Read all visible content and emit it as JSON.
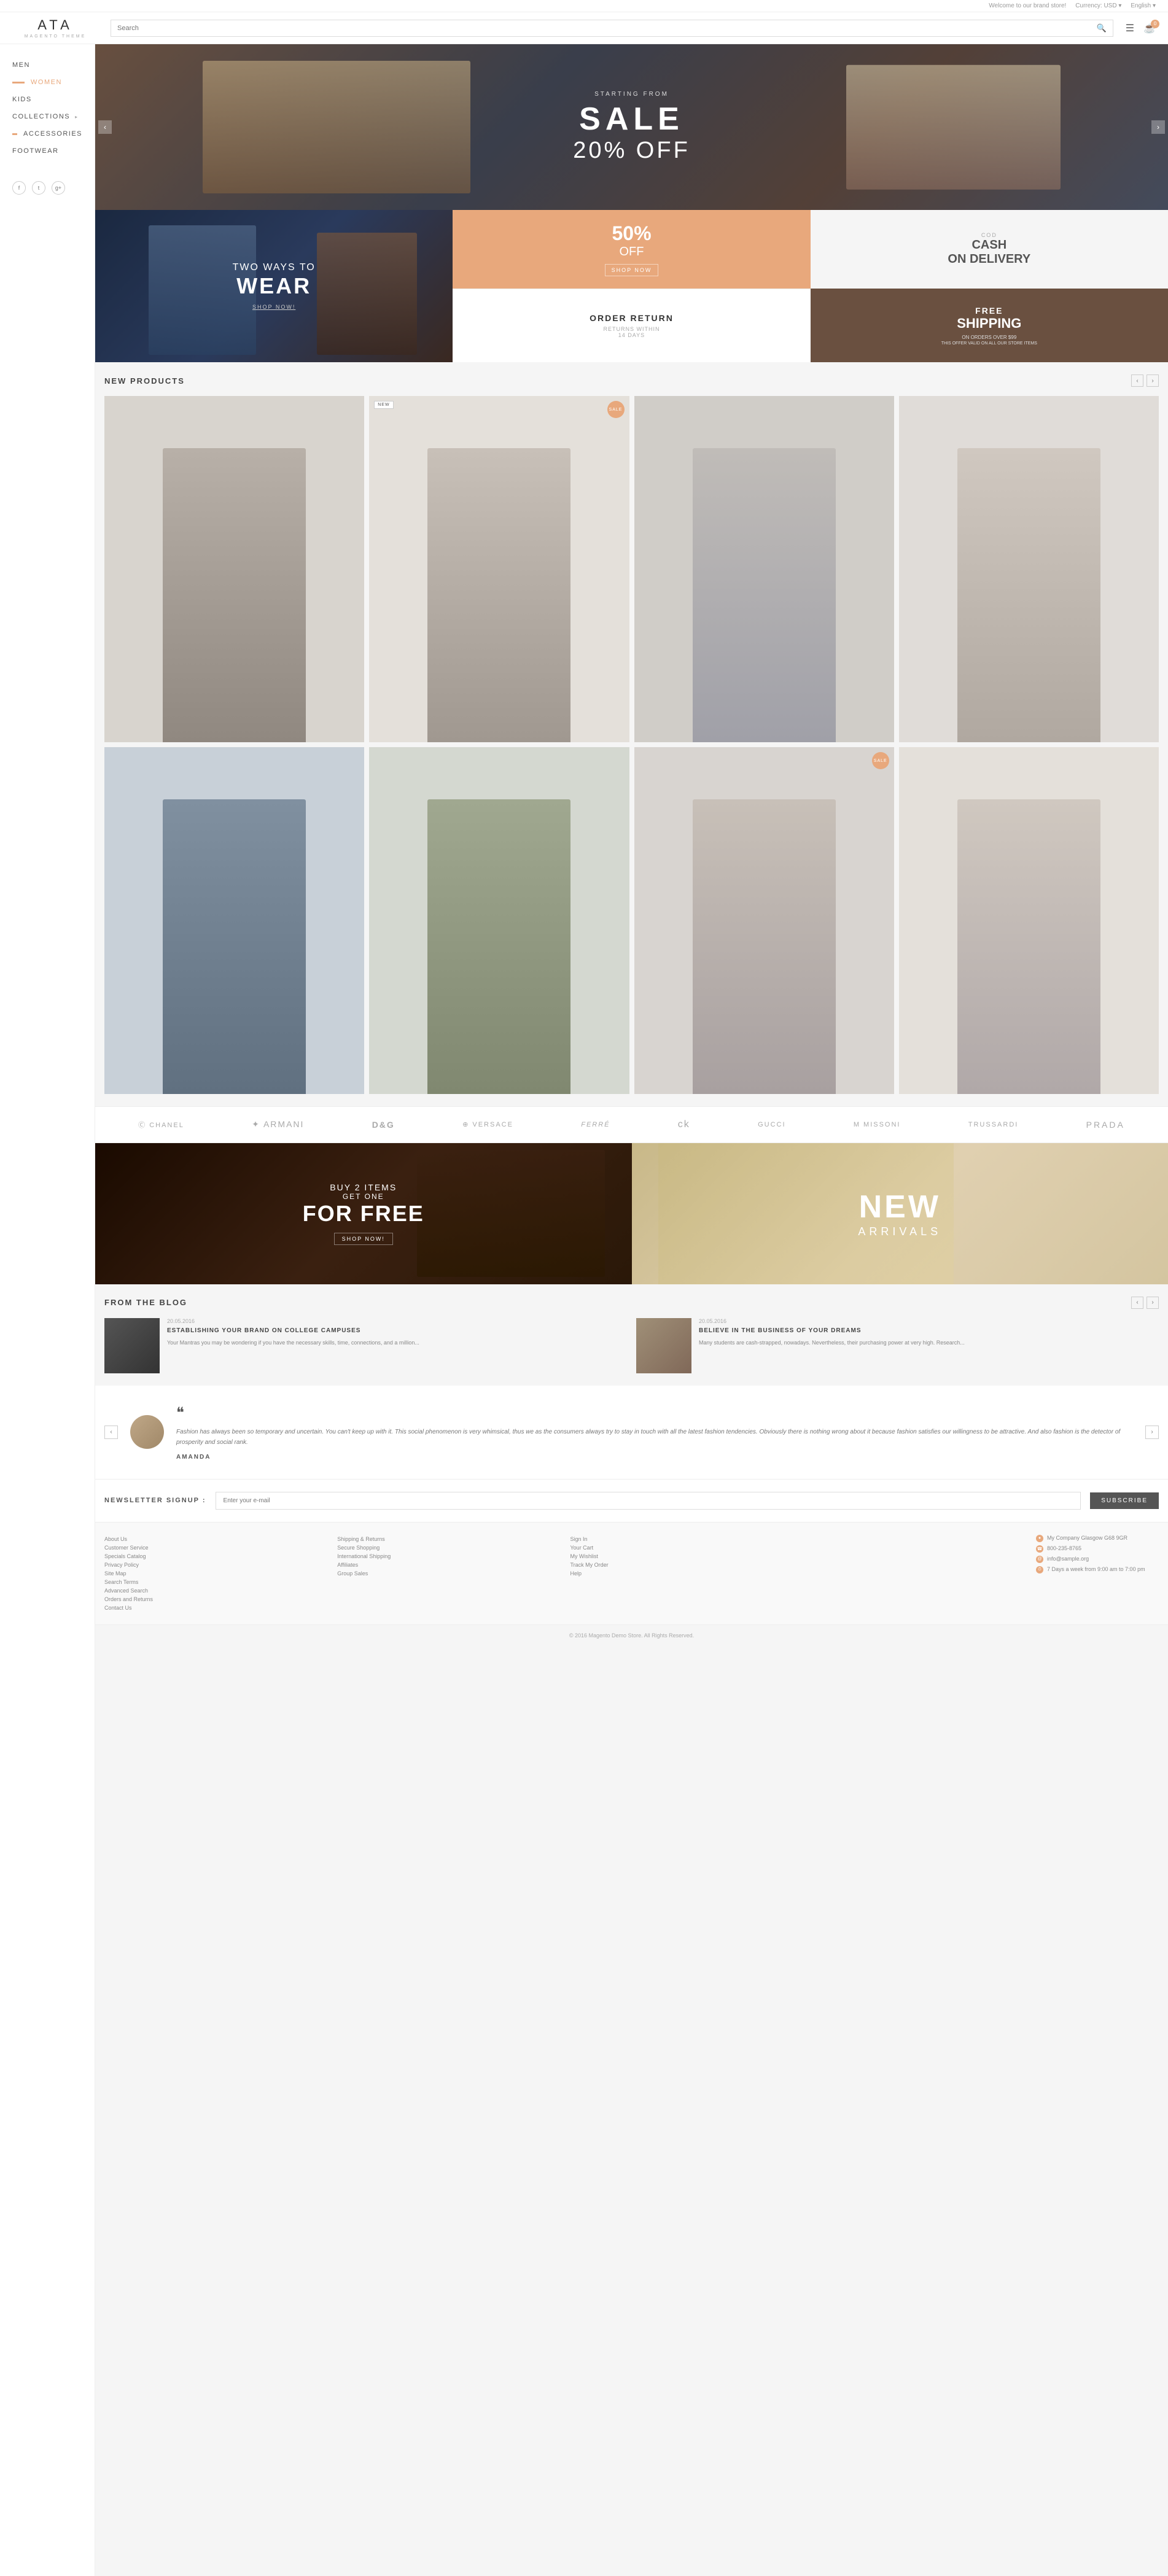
{
  "topbar": {
    "welcome": "Welcome to our brand store!",
    "currency_label": "Currency:",
    "currency": "USD",
    "language": "English"
  },
  "header": {
    "logo": "ATA",
    "logo_sub": "MAGENTO THEME",
    "search_placeholder": "Search",
    "cart_count": "0"
  },
  "sidebar": {
    "items": [
      {
        "label": "MEN",
        "has_badge": false
      },
      {
        "label": "WOMEN",
        "has_badge": true
      },
      {
        "label": "KIDS",
        "has_badge": false
      },
      {
        "label": "COLLECTIONS",
        "has_arrow": true
      },
      {
        "label": "ACCESSORIES",
        "has_badge": true
      },
      {
        "label": "FOOTWEAR",
        "has_badge": false
      }
    ],
    "social": [
      "f",
      "t",
      "g+"
    ]
  },
  "hero": {
    "starting_from": "STARTING FROM",
    "sale": "SALE",
    "off": "20% OFF"
  },
  "promo": {
    "two_ways": "TWO WAYS TO",
    "wear": "WEAR",
    "shop_now": "SHOP NOW!",
    "fifty_off": "50%",
    "off_label": "OFF",
    "shop_now2": "SHOP NOW",
    "cod": "COD",
    "cash": "CASH",
    "on_delivery": "ON DELIVERY",
    "order_return": "ORDER RETURN",
    "returns_within": "RETURNS WITHIN",
    "days": "14 DAYS",
    "free": "FREE",
    "shipping": "SHIPPING",
    "on_orders": "ON ORDERS OVER $99",
    "offer_valid": "THIS OFFER VALID ON ALL OUR STORE ITEMS"
  },
  "new_products": {
    "title": "NEW PRODUCTS",
    "items": [
      {
        "id": 1,
        "badge": "",
        "color": "#d0c8c0"
      },
      {
        "id": 2,
        "badge": "NEW",
        "sale": "SALE",
        "color": "#e0ddd8"
      },
      {
        "id": 3,
        "badge": "",
        "color": "#c8c5c0"
      },
      {
        "id": 4,
        "badge": "",
        "color": "#d8d5d0"
      },
      {
        "id": 5,
        "badge": "",
        "color": "#c0c8d0"
      },
      {
        "id": 6,
        "badge": "",
        "color": "#ccd0c8"
      },
      {
        "id": 7,
        "badge": "",
        "sale": "SALE",
        "color": "#d4d0cc"
      },
      {
        "id": 8,
        "badge": "",
        "color": "#e0ddd8"
      }
    ]
  },
  "brands": {
    "items": [
      "CHANEL",
      "◤◢ ARMANI",
      "D&G",
      "⊕ VERSACE",
      "FERRE",
      "ck",
      "GUCCI",
      "M MISSONI",
      "TRUSSARDI",
      "PRADA"
    ]
  },
  "promo_banners": {
    "buy2": "BUY 2 ITEMS",
    "get_one": "GET ONE",
    "for_free": "FOR FREE",
    "shop_now": "SHOP NOW!",
    "new_text": "NEW",
    "arrivals": "ARRIVALS"
  },
  "blog": {
    "title": "FROM THE BLOG",
    "posts": [
      {
        "date": "20.05.2016",
        "title": "ESTABLISHING YOUR BRAND ON COLLEGE CAMPUSES",
        "excerpt": "Your Mantras you may be wondering if you have the necessary skills, time, connections, and a million..."
      },
      {
        "date": "20.05.2016",
        "title": "BELIEVE IN THE BUSINESS OF YOUR DREAMS",
        "excerpt": "Many students are cash-strapped, nowadays. Nevertheless, their purchasing power at very high. Research..."
      }
    ]
  },
  "testimonial": {
    "quote": "Fashion has always been so temporary and uncertain. You can't keep up with it. This social phenomenon is very whimsical, thus we as the consumers always try to stay in touch with all the latest fashion tendencies. Obviously there is nothing wrong about it because fashion satisfies our willingness to be attractive. And also fashion is the detector of prosperity and social rank.",
    "author": "AMANDA"
  },
  "newsletter": {
    "label": "NEWSLETTER SIGNUP :",
    "placeholder": "Enter your e-mail",
    "subscribe": "SUBSCRIBE"
  },
  "footer": {
    "col1": {
      "links": [
        "About Us",
        "Customer Service",
        "Specials Catalog",
        "Privacy Policy",
        "Site Map",
        "Search Terms",
        "Advanced Search",
        "Orders and Returns",
        "Contact Us"
      ]
    },
    "col2": {
      "links": [
        "Shipping & Returns",
        "Secure Shopping",
        "International Shipping",
        "Affiliates",
        "Group Sales"
      ]
    },
    "col3": {
      "links": [
        "Sign In",
        "Your Cart",
        "My Wishlist",
        "Track My Order",
        "Help"
      ]
    },
    "contact": {
      "address": "My Company Glasgow G68 9GR",
      "phone": "800-235-8765",
      "email": "info@sample.org",
      "hours": "7 Days a week from 9:00 am to 7:00 pm"
    }
  },
  "footer_bottom": {
    "text": "© 2016 Magento Demo Store. All Rights Reserved."
  }
}
